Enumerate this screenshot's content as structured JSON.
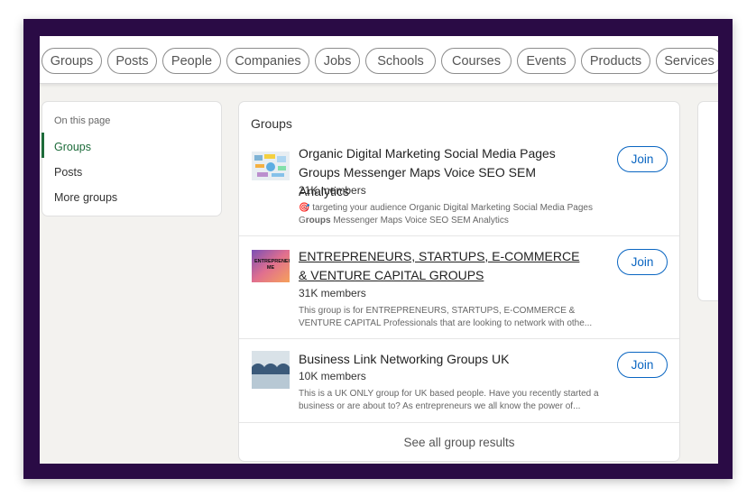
{
  "filters": [
    "Groups",
    "Posts",
    "People",
    "Companies",
    "Jobs",
    "Schools",
    "Courses",
    "Events",
    "Products",
    "Services"
  ],
  "sidebar": {
    "heading": "On this page",
    "items": [
      "Groups",
      "Posts",
      "More groups"
    ]
  },
  "main": {
    "title": "Groups",
    "join_label": "Join",
    "groups": [
      {
        "name": "Organic Digital Marketing Social Media Pages Groups Messenger Maps Voice SEO SEM Analytics",
        "members": "21K members",
        "desc_pre": "🎯 targeting your audience Organic Digital Marketing Social Media Pages G",
        "desc_bold": "roups",
        "desc_post": " Messenger Maps Voice SEO SEM Analytics"
      },
      {
        "name": "ENTREPRENEURS, STARTUPS, E-COMMERCE & VENTURE CAPITAL GROUPS",
        "members": "31K members",
        "desc": "This group is for ENTREPRENEURS, STARTUPS, E-COMMERCE & VENTURE CAPITAL Professionals that are looking to network with othe...",
        "thumb_text": "ENTREPRENEUR ME"
      },
      {
        "name": "Business Link Networking Groups UK",
        "members": "10K members",
        "desc": "This is a UK ONLY group for UK based people. Have you recently started a business or are about to? As entrepreneurs we all know the power of..."
      }
    ],
    "see_all": "See all group results"
  },
  "colors": {
    "frame": "#2a0b45",
    "accent_green": "#1d6b3a",
    "join_blue": "#0a66c2"
  }
}
